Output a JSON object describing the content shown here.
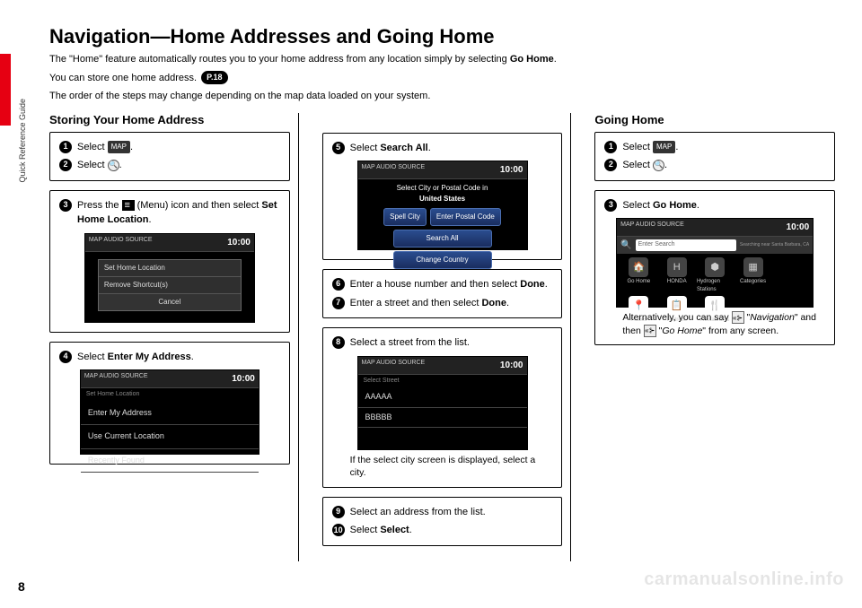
{
  "page": {
    "number": "8",
    "side_label": "Quick Reference Guide",
    "watermark": "carmanualsonline.info"
  },
  "header": {
    "title": "Navigation—Home Addresses and Going Home",
    "intro1_a": "The \"Home\" feature automatically routes you to your home address from any location simply by selecting ",
    "intro1_b": "Go Home",
    "intro1_c": ".",
    "intro2_a": "You can store one home address. ",
    "intro2_pill": "P.18",
    "intro3": "The order of the steps may change depending on the map data loaded on your system."
  },
  "storing": {
    "heading": "Storing Your Home Address",
    "step1_a": "Select ",
    "step1_map": "MAP",
    "step1_b": ".",
    "step2_a": "Select ",
    "step2_b": ".",
    "step3_a": "Press the ",
    "step3_b": " (Menu) icon and then select ",
    "step3_c": "Set Home Location",
    "step3_d": ".",
    "screen1": {
      "tabs": "MAP   AUDIO   SOURCE",
      "clock": "10:00",
      "opt1": "Set Home Location",
      "opt2": "Remove Shortcut(s)",
      "opt3": "Cancel"
    },
    "step4_a": "Select ",
    "step4_b": "Enter My Address",
    "step4_c": ".",
    "screen2": {
      "tabs": "MAP   AUDIO   SOURCE",
      "clock": "10:00",
      "hdr": "Set Home Location",
      "r1": "Enter My Address",
      "r2": "Use Current Location",
      "r3": "Recently Found"
    },
    "step5_a": "Select ",
    "step5_b": "Search All",
    "step5_c": ".",
    "screen3": {
      "tabs": "MAP   AUDIO   SOURCE",
      "clock": "10:00",
      "hdr_a": "Select City or Postal Code in",
      "hdr_b": "United States",
      "b1": "Spell City",
      "b2": "Enter Postal Code",
      "b3": "Search All",
      "b4": "Change Country"
    },
    "step6_a": "Enter a house number and then select ",
    "step6_b": "Done",
    "step6_c": ".",
    "step7_a": "Enter a street and then select ",
    "step7_b": "Done",
    "step7_c": ".",
    "step8": "Select a street from the list.",
    "screen4": {
      "tabs": "MAP   AUDIO   SOURCE",
      "clock": "10:00",
      "hdr": "Select Street",
      "r1": "AAAAA",
      "r2": "BBBBB"
    },
    "step8_note": "If the select city screen is displayed, select a city.",
    "step9": "Select an address from the list.",
    "step10_a": "Select ",
    "step10_b": "Select",
    "step10_c": "."
  },
  "going": {
    "heading": "Going Home",
    "step1_a": "Select ",
    "step1_map": "MAP",
    "step1_b": ".",
    "step2_a": "Select ",
    "step2_b": ".",
    "step3_a": "Select ",
    "step3_b": "Go Home",
    "step3_c": ".",
    "screen5": {
      "tabs": "MAP   AUDIO   SOURCE",
      "clock": "10:00",
      "search": "Enter Search",
      "dest": "Searching near Santa Barbara, CA",
      "c1": "Go Home",
      "c2": "HONDA",
      "c3": "Hydrogen Stations",
      "c4": "Categories",
      "c5": "Places",
      "c6": "Address",
      "c7": "Restaurants"
    },
    "alt_a": "Alternatively, you can say ",
    "alt_b": " \"",
    "alt_c": "Navigation",
    "alt_d": "\" and then ",
    "alt_e": " \"",
    "alt_f": "Go Home",
    "alt_g": "\" from any screen."
  }
}
